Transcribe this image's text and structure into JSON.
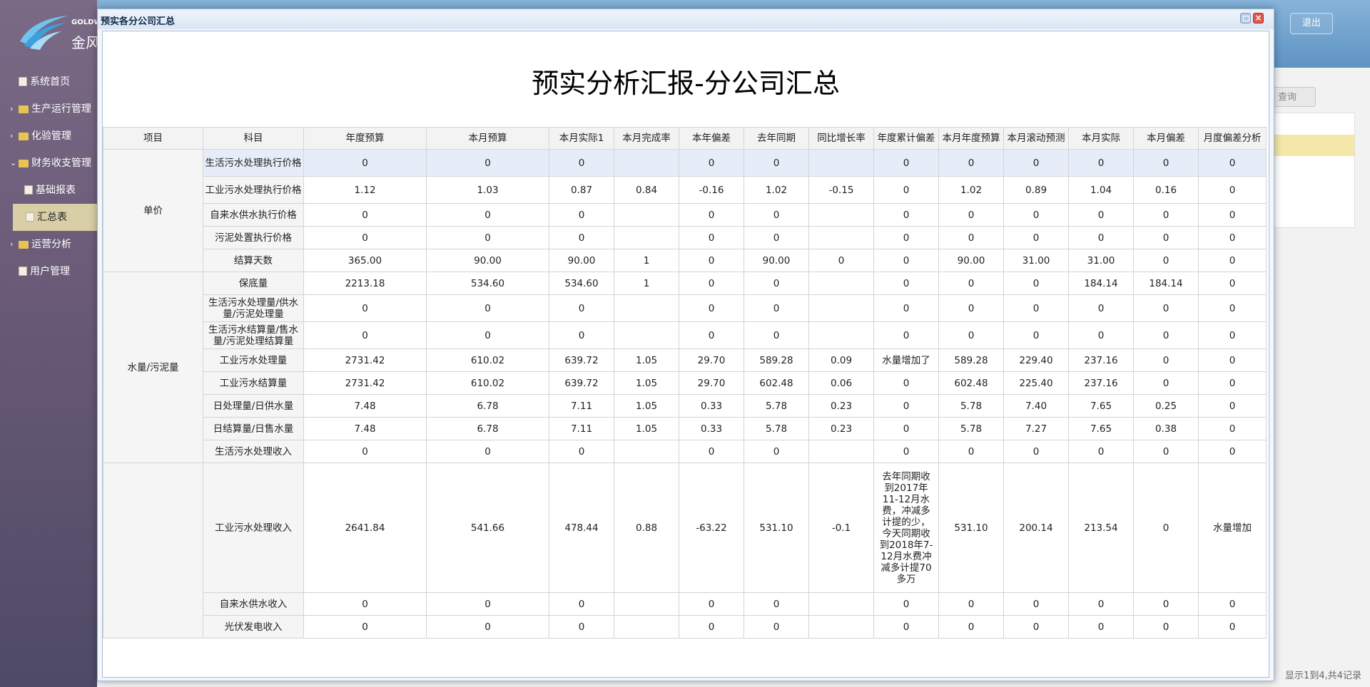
{
  "sidebar": {
    "logo_en": "GOLDW",
    "logo_cn": "金风",
    "items": [
      {
        "label": "系统首页",
        "type": "doc",
        "level": 0
      },
      {
        "label": "生产运行管理",
        "type": "folder",
        "level": 0,
        "arrow": "›"
      },
      {
        "label": "化验管理",
        "type": "folder",
        "level": 0,
        "arrow": "›"
      },
      {
        "label": "财务收支管理",
        "type": "folder",
        "level": 0,
        "arrow": "⌄"
      },
      {
        "label": "基础报表",
        "type": "doc",
        "level": 1
      },
      {
        "label": "汇总表",
        "type": "doc",
        "level": 1,
        "active": true
      },
      {
        "label": "运营分析",
        "type": "folder",
        "level": 0,
        "arrow": "›"
      },
      {
        "label": "用户管理",
        "type": "doc",
        "level": 0
      }
    ]
  },
  "topbar": {
    "logout_label": "退出"
  },
  "background": {
    "query_label": "查询",
    "pager_text": "显示1到4,共4记录"
  },
  "dialog": {
    "title": "预实各分公司汇总",
    "close_glyph": "×",
    "report_title": "预实分析汇报-分公司汇总"
  },
  "table": {
    "headers": [
      "项目",
      "科目",
      "年度预算",
      "本月预算",
      "本月实际1",
      "本月完成率",
      "本年偏差",
      "去年同期",
      "同比增长率",
      "年度累计偏差",
      "本月年度预算",
      "本月滚动预测",
      "本月实际",
      "本月偏差",
      "月度偏差分析"
    ],
    "groups": [
      {
        "name": "单价",
        "rows": [
          {
            "subject": "生活污水处理执行价格",
            "cells": [
              "0",
              "0",
              "0",
              "",
              "0",
              "0",
              "",
              "0",
              "0",
              "0",
              "0",
              "0",
              "0"
            ],
            "cls": "first tall2"
          },
          {
            "subject": "工业污水处理执行价格",
            "cells": [
              "1.12",
              "1.03",
              "0.87",
              "0.84",
              "-0.16",
              "1.02",
              "-0.15",
              "0",
              "1.02",
              "0.89",
              "1.04",
              "0.16",
              "0"
            ],
            "cls": "tall2"
          },
          {
            "subject": "自来水供水执行价格",
            "cells": [
              "0",
              "0",
              "0",
              "",
              "0",
              "0",
              "",
              "0",
              "0",
              "0",
              "0",
              "0",
              "0"
            ]
          },
          {
            "subject": "污泥处置执行价格",
            "cells": [
              "0",
              "0",
              "0",
              "",
              "0",
              "0",
              "",
              "0",
              "0",
              "0",
              "0",
              "0",
              "0"
            ]
          },
          {
            "subject": "结算天数",
            "cells": [
              "365.00",
              "90.00",
              "90.00",
              "1",
              "0",
              "90.00",
              "0",
              "0",
              "90.00",
              "31.00",
              "31.00",
              "0",
              "0"
            ]
          }
        ]
      },
      {
        "name": "水量/污泥量",
        "rows": [
          {
            "subject": "保底量",
            "cells": [
              "2213.18",
              "534.60",
              "534.60",
              "1",
              "0",
              "0",
              "",
              "0",
              "0",
              "0",
              "184.14",
              "184.14",
              "0"
            ]
          },
          {
            "subject": "生活污水处理量/供水量/污泥处理量",
            "cells": [
              "0",
              "0",
              "0",
              "",
              "0",
              "0",
              "",
              "0",
              "0",
              "0",
              "0",
              "0",
              "0"
            ],
            "cls": "tall2"
          },
          {
            "subject": "生活污水结算量/售水量/污泥处理结算量",
            "cells": [
              "0",
              "0",
              "0",
              "",
              "0",
              "0",
              "",
              "0",
              "0",
              "0",
              "0",
              "0",
              "0"
            ],
            "cls": "tall2"
          },
          {
            "subject": "工业污水处理量",
            "cells": [
              "2731.42",
              "610.02",
              "639.72",
              "1.05",
              "29.70",
              "589.28",
              "0.09",
              "水量增加了",
              "589.28",
              "229.40",
              "237.16",
              "0",
              "0"
            ]
          },
          {
            "subject": "工业污水结算量",
            "cells": [
              "2731.42",
              "610.02",
              "639.72",
              "1.05",
              "29.70",
              "602.48",
              "0.06",
              "0",
              "602.48",
              "225.40",
              "237.16",
              "0",
              "0"
            ]
          },
          {
            "subject": "日处理量/日供水量",
            "cells": [
              "7.48",
              "6.78",
              "7.11",
              "1.05",
              "0.33",
              "5.78",
              "0.23",
              "0",
              "5.78",
              "7.40",
              "7.65",
              "0.25",
              "0"
            ]
          },
          {
            "subject": "日结算量/日售水量",
            "cells": [
              "7.48",
              "6.78",
              "7.11",
              "1.05",
              "0.33",
              "5.78",
              "0.23",
              "0",
              "5.78",
              "7.27",
              "7.65",
              "0.38",
              "0"
            ]
          },
          {
            "subject": "生活污水处理收入",
            "cells": [
              "0",
              "0",
              "0",
              "",
              "0",
              "0",
              "",
              "0",
              "0",
              "0",
              "0",
              "0",
              "0"
            ]
          }
        ]
      },
      {
        "name": "",
        "rows": [
          {
            "subject": "工业污水处理收入",
            "cells": [
              "2641.84",
              "541.66",
              "478.44",
              "0.88",
              "-63.22",
              "531.10",
              "-0.1",
              "去年同期收到2017年11-12月水费，冲减多计提的少，今天同期收到2018年7-12月水费冲减多计提70多万",
              "531.10",
              "200.14",
              "213.54",
              "0",
              "水量增加"
            ],
            "cls": "huge"
          },
          {
            "subject": "自来水供水收入",
            "cells": [
              "0",
              "0",
              "0",
              "",
              "0",
              "0",
              "",
              "0",
              "0",
              "0",
              "0",
              "0",
              "0"
            ]
          },
          {
            "subject": "光伏发电收入",
            "cells": [
              "0",
              "0",
              "0",
              "",
              "0",
              "0",
              "",
              "0",
              "0",
              "0",
              "0",
              "0",
              "0"
            ]
          }
        ]
      }
    ]
  }
}
